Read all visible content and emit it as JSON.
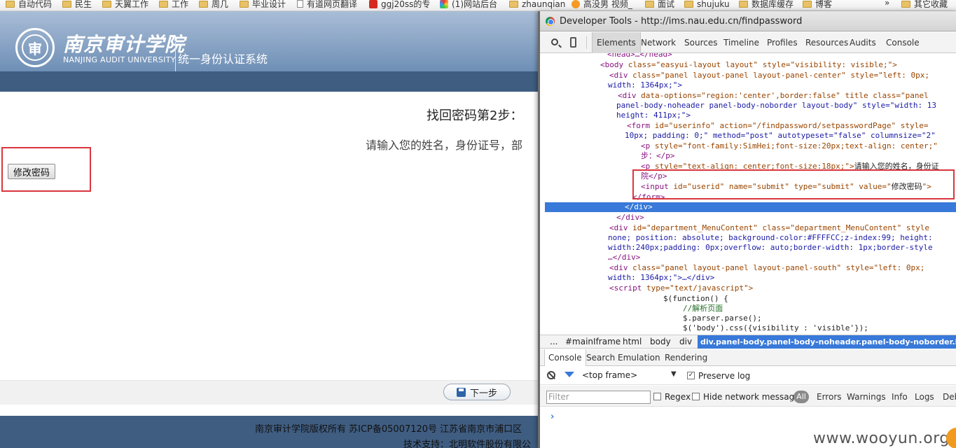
{
  "bookmarks": {
    "items": [
      {
        "label": "自动代码",
        "icon": "folder-icon"
      },
      {
        "label": "民生",
        "icon": "folder-icon"
      },
      {
        "label": "天翼工作",
        "icon": "folder-icon"
      },
      {
        "label": "工作",
        "icon": "folder-icon"
      },
      {
        "label": "周几",
        "icon": "folder-icon"
      },
      {
        "label": "毕业设计",
        "icon": "folder-icon"
      },
      {
        "label": "有道网页翻译",
        "icon": "page-icon"
      },
      {
        "label": "ggj20ss的专",
        "icon": "csdn-icon"
      },
      {
        "label": "(1)网站后台",
        "icon": "site-icon"
      },
      {
        "label": "zhaunqian",
        "icon": "folder-icon"
      },
      {
        "label": "高没男 视频_",
        "icon": "face-icon"
      },
      {
        "label": "面试",
        "icon": "folder-icon"
      },
      {
        "label": "shujuku",
        "icon": "folder-icon"
      },
      {
        "label": "数据库缓存",
        "icon": "folder-icon"
      },
      {
        "label": "博客",
        "icon": "folder-icon"
      }
    ],
    "more": "»",
    "other": "其它收藏"
  },
  "site": {
    "logo_char": "审",
    "school_cn": "南京审计学院",
    "school_en": "NANJING AUDIT UNIVERSITY",
    "system_name": "统一身份认证系统",
    "step_title": "找回密码第2步：",
    "step_desc": "请输入您的姓名，身份证号，部",
    "submit_label": "修改密码",
    "next_label": "下一步",
    "footer_line1": "南京审计学院版权所有 苏ICP备05007120号 江苏省南京市浦口区",
    "footer_line2": "技术支持：北明软件股份有限公"
  },
  "devtools": {
    "title": "Developer Tools - http://ims.nau.edu.cn/findpassword",
    "tabs": [
      "Elements",
      "Network",
      "Sources",
      "Timeline",
      "Profiles",
      "Resources",
      "Audits",
      "Console"
    ],
    "active_tab": "Elements",
    "breadcrumbs": [
      "...",
      "#mainIframe",
      "html",
      "body",
      "div",
      "div.panel-body.panel-body-noheader.panel-body-noborder.layout-bo"
    ],
    "drawer_tabs": [
      "Console",
      "Search",
      "Emulation",
      "Rendering"
    ],
    "frame_select": "<top frame>",
    "preserve_log": "Preserve log",
    "filter_placeholder": "Filter",
    "regex": "Regex",
    "hide_network": "Hide network messages",
    "all_label": "All",
    "levels": [
      "Errors",
      "Warnings",
      "Info",
      "Logs",
      "Deb"
    ],
    "prompt": "›",
    "watermark": "www.wooyun.org",
    "code": {
      "l0": "<head>…</head>",
      "l1_tag": "<body",
      "l1_attrs": " class=\"easyui-layout layout\" style=\"visibility: visible;\">",
      "l2_tag": "<div",
      "l2_attrs": " class=\"panel layout-panel layout-panel-center\" style=\"left: 0px;",
      "l3": "width: 1364px;\">",
      "l4_tag": "<div",
      "l4_attrs": " data-options=\"region:'center',border:false\" title class=\"panel",
      "l5": "panel-body-noheader panel-body-noborder layout-body\" style=\"width: 13",
      "l6": "height: 411px;\">",
      "l7_tag": "<form",
      "l7_attrs": " id=\"userinfo\" action=\"/findpassword/setpasswordPage\" style=",
      "l8": "10px; padding: 0;\" method=\"post\" autotypeset=\"false\" columnsize=\"2\"",
      "l9_tag": "<p",
      "l9_attrs": " style=\"font-family:SimHei;font-size:20px;text-align: center;\"",
      "l10": "步：</p>",
      "l11_tag": "<p",
      "l11_attrs": " style=\"text-align: center;font-size:18px;\">",
      "l11_text": "请输入您的姓名，身份证",
      "l12": "院</p>",
      "l13_tag": "<input",
      "l13_attrs": " id=\"userid\" name=\"submit\" type=\"submit\" value=\"",
      "l13_value": "修改密码",
      "l13_end": "\">",
      "l14": "</form>",
      "l15": "</div>",
      "l16": "</div>",
      "l17_tag": "<div",
      "l17_attrs": " id=\"department_MenuContent\" class=\"department_MenuContent\" style",
      "l18": "none; position: absolute; background-color:#FFFFCC;z-index:99; height:",
      "l19": "width:240px;padding: 0px;overflow: auto;border-width: 1px;border-style",
      "l20": "…</div>",
      "l21_tag": "<div",
      "l21_attrs": " class=\"panel layout-panel layout-panel-south\" style=\"left: 0px;",
      "l22": "width: 1364px;\">…</div>",
      "l23_tag": "<script",
      "l23_attrs": " type=\"text/javascript\">",
      "l24": "$(function() {",
      "l25": "//解析页面",
      "l26": "$.parser.parse();",
      "l27": "$('body').css({visibility : 'visible'});"
    }
  }
}
